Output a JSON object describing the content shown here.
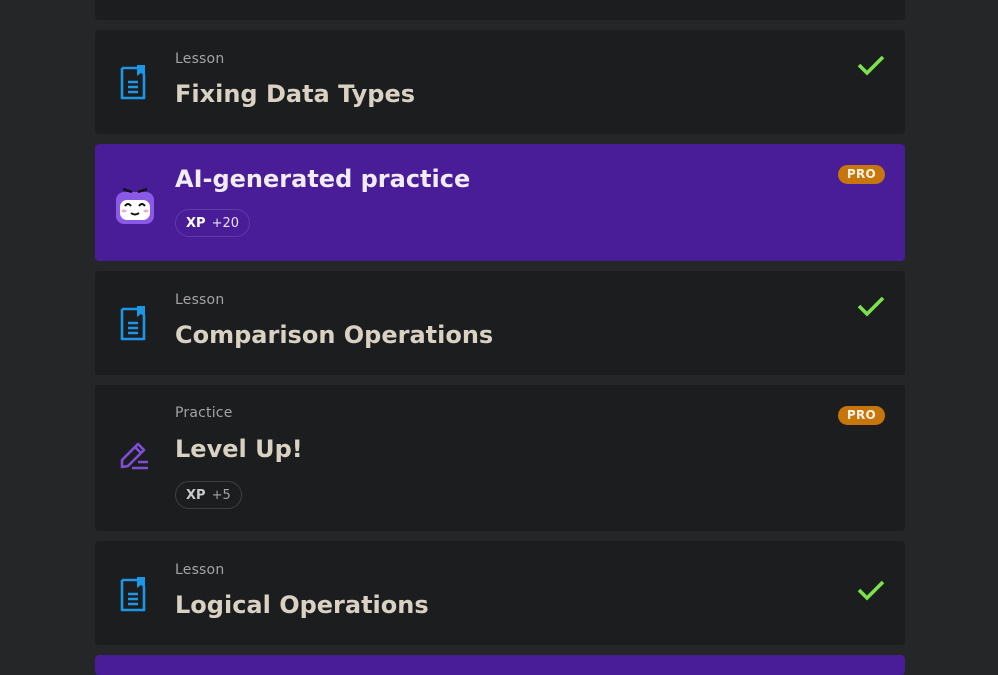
{
  "items": [
    {
      "kind": "",
      "title": ""
    },
    {
      "kind": "Lesson",
      "title": "Fixing Data Types",
      "status": "completed"
    },
    {
      "kind": "",
      "title": "AI-generated practice",
      "badge": "PRO",
      "xp_label": "XP",
      "xp_value": "+20"
    },
    {
      "kind": "Lesson",
      "title": "Comparison Operations",
      "status": "completed"
    },
    {
      "kind": "Practice",
      "title": "Level Up!",
      "badge": "PRO",
      "xp_label": "XP",
      "xp_value": "+5"
    },
    {
      "kind": "Lesson",
      "title": "Logical Operations",
      "status": "completed"
    }
  ],
  "colors": {
    "page_bg": "#252627",
    "card_bg": "#1c1d1f",
    "ai_card_bg": "#481d97",
    "lesson_icon": "#1e96e6",
    "practice_icon": "#7e4fd6",
    "check": "#7be24e",
    "pro_badge": "#c7760d"
  },
  "icons": {
    "lesson": "lesson-document-icon",
    "practice": "pencil-icon",
    "ai": "ai-robot-face-icon",
    "done": "checkmark-icon"
  }
}
